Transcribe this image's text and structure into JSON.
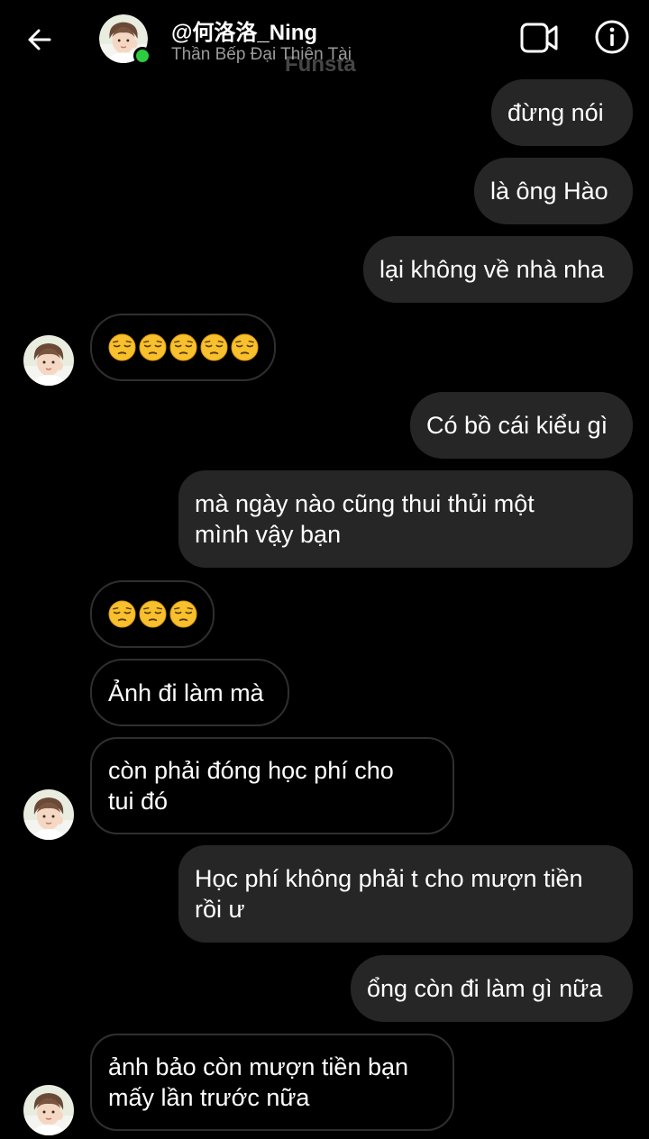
{
  "header": {
    "username": "@何洛洛_Ning",
    "subtitle": "Thần Bếp Đại Thiên Tài",
    "watermark": "Funsta",
    "online_color": "#2ecc40"
  },
  "icons": {
    "back": "arrow-left-icon",
    "video": "video-camera-icon",
    "info": "info-circle-icon",
    "emoji": "pensive-face-emoji"
  },
  "colors": {
    "background": "#000000",
    "outgoing_bubble": "#262626",
    "incoming_border": "#2f2f2f"
  },
  "messages": [
    {
      "from": "me",
      "text": "đừng nói"
    },
    {
      "from": "me",
      "text": "là ông Hào"
    },
    {
      "from": "me",
      "text": "lại không về nhà nha"
    },
    {
      "from": "them",
      "emoji_count": 5
    },
    {
      "from": "me",
      "text": "Có bồ cái kiểu gì"
    },
    {
      "from": "me",
      "line1": "mà ngày nào cũng thui thủi một",
      "line2": "mình vậy bạn"
    },
    {
      "from": "them",
      "emoji_count": 3
    },
    {
      "from": "them",
      "text": "Ảnh đi làm mà"
    },
    {
      "from": "them",
      "line1": "còn phải đóng học phí cho",
      "line2": "tui đó"
    },
    {
      "from": "me",
      "line1": "Học phí không phải t cho mượn tiền",
      "line2": "rồi ư"
    },
    {
      "from": "me",
      "text": "ổng còn đi làm gì nữa"
    },
    {
      "from": "them",
      "line1": "ảnh bảo còn mượn tiền bạn",
      "line2": "mấy lần trước nữa"
    }
  ]
}
